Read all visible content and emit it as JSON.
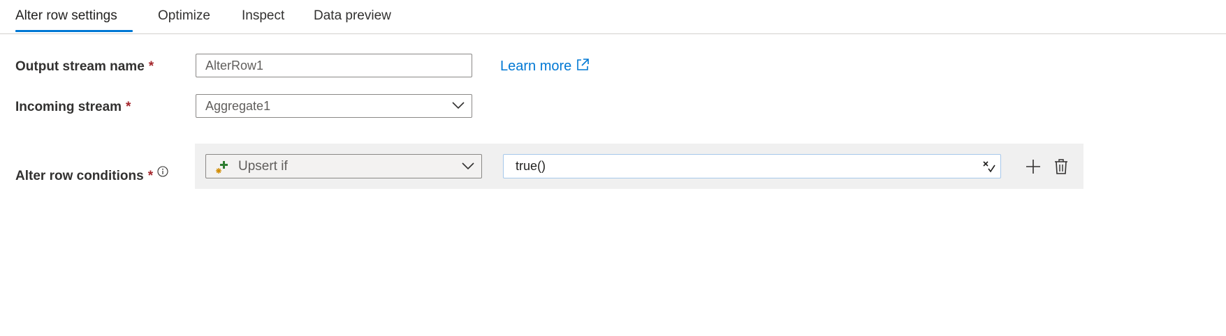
{
  "tabs": [
    {
      "label": "Alter row settings",
      "active": true
    },
    {
      "label": "Optimize",
      "active": false
    },
    {
      "label": "Inspect",
      "active": false
    },
    {
      "label": "Data preview",
      "active": false
    }
  ],
  "form": {
    "output_stream": {
      "label": "Output stream name",
      "required_mark": "*",
      "value": "AlterRow1"
    },
    "learn_more": {
      "label": "Learn more",
      "icon": "external-link-icon"
    },
    "incoming_stream": {
      "label": "Incoming stream",
      "required_mark": "*",
      "selected": "Aggregate1"
    },
    "alter_row_conditions": {
      "label": "Alter row conditions",
      "required_mark": "*",
      "info_icon": "info-icon",
      "rows": [
        {
          "condition_type": "Upsert if",
          "condition_type_icon": "upsert-icon",
          "expression": "true()"
        }
      ]
    }
  },
  "colors": {
    "accent": "#0078d4",
    "required": "#a4262c",
    "panel_bg": "#f0f0f0"
  }
}
